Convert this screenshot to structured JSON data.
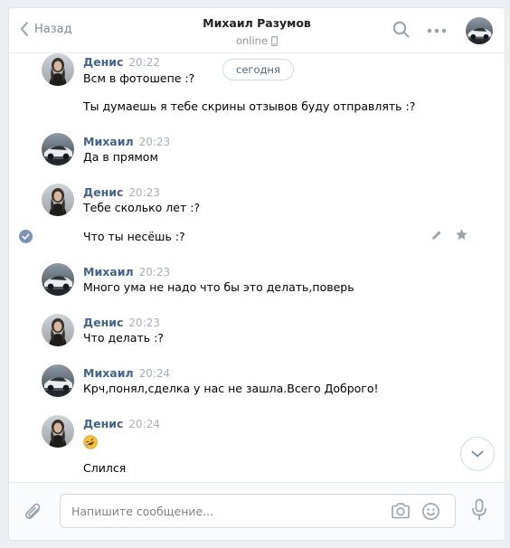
{
  "header": {
    "back_label": "Назад",
    "title": "Михаил Разумов",
    "status": "online"
  },
  "date_pill": "сегодня",
  "messages": [
    {
      "author": "Денис",
      "time": "20:22",
      "texts": [
        "Всм в фотошепе :?",
        "Ты думаешь я тебе скрины отзывов буду отправлять :?"
      ]
    },
    {
      "author": "Михаил",
      "time": "20:23",
      "texts": [
        "Да в прямом"
      ]
    },
    {
      "author": "Денис",
      "time": "20:23",
      "texts": [
        "Тебе сколько лет :?",
        "Что ты несёшь :?"
      ]
    },
    {
      "author": "Михаил",
      "time": "20:23",
      "texts": [
        "Много ума не надо что бы это делать,поверь"
      ]
    },
    {
      "author": "Денис",
      "time": "20:23",
      "texts": [
        "Что делать :?"
      ]
    },
    {
      "author": "Михаил",
      "time": "20:24",
      "texts": [
        "Крч,понял,сделка у нас не зашла.Всего Доброго!"
      ]
    },
    {
      "author": "Денис",
      "time": "20:24",
      "texts": [
        "Слился"
      ]
    }
  ],
  "composer": {
    "placeholder": "Напишите сообщение..."
  },
  "colors": {
    "author": "#42648b",
    "accent": "#5181b8",
    "muted": "#a6afb9"
  },
  "icons": [
    "chevron-left-icon",
    "search-icon",
    "more-icon",
    "phone-icon",
    "check-circle-icon",
    "pencil-icon",
    "star-icon",
    "rofl-emoji-icon",
    "chevron-down-icon",
    "paperclip-icon",
    "camera-icon",
    "smile-icon",
    "microphone-icon"
  ]
}
